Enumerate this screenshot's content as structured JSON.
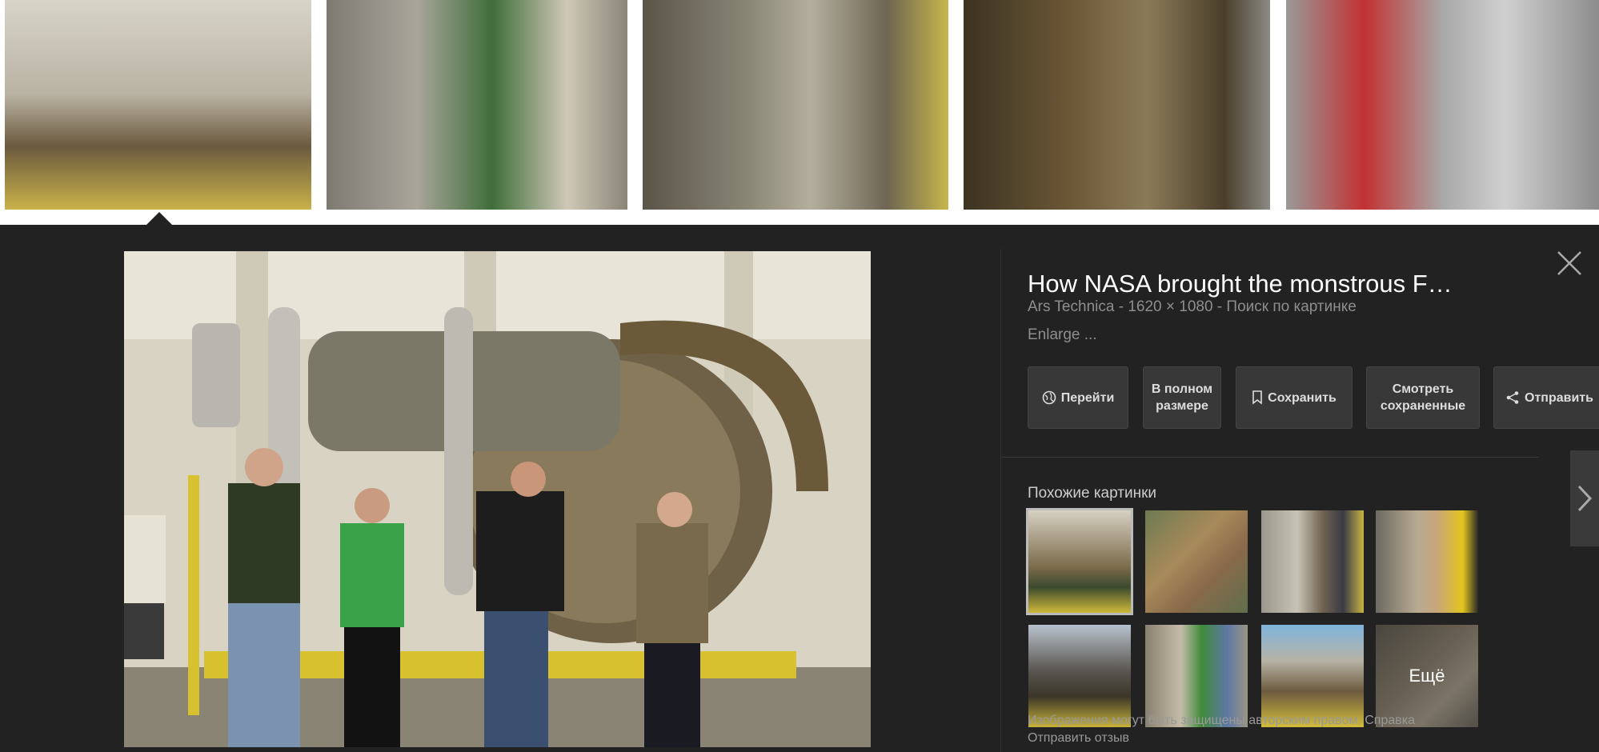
{
  "title_text": "How NASA brought the monstrous F…",
  "meta": {
    "source": "Ars Technica",
    "size": "1620 × 1080",
    "sep": " - ",
    "search_link": "Поиск по картинке"
  },
  "description": "Enlarge ...",
  "buttons": {
    "visit": "Перейти",
    "full_size": "В полном размере",
    "save": "Сохранить",
    "view_saved": "Смотреть сохраненные",
    "share": "Отправить"
  },
  "similar": {
    "heading": "Похожие картинки",
    "more_label": "Ещё"
  },
  "footer": {
    "copyright": "Изображения могут быть защищены авторским правом.",
    "help": "Справка",
    "feedback": "Отправить отзыв"
  },
  "icons": {
    "close": "close-icon",
    "globe": "globe-icon",
    "bookmark": "bookmark-icon",
    "share": "share-icon",
    "next": "chevron-right-icon"
  },
  "colors": {
    "panel_bg": "#222222",
    "button_bg": "#383838",
    "text_primary": "#ffffff",
    "text_secondary": "#8e8e8e"
  }
}
